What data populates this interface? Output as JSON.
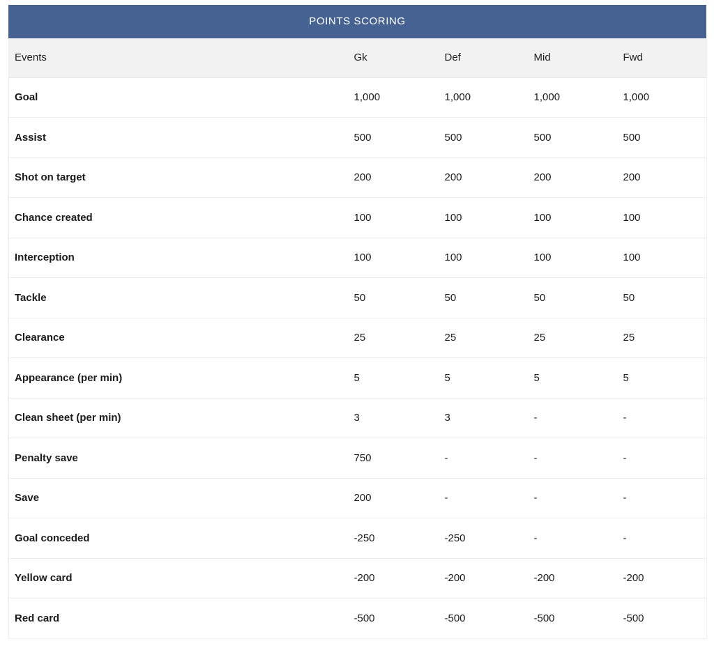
{
  "table": {
    "title": "POINTS SCORING",
    "accent_color": "#456293",
    "header_bg_color": "#f2f2f2",
    "columns": [
      {
        "key": "events",
        "label": "Events"
      },
      {
        "key": "gk",
        "label": "Gk"
      },
      {
        "key": "def",
        "label": "Def"
      },
      {
        "key": "mid",
        "label": "Mid"
      },
      {
        "key": "fwd",
        "label": "Fwd"
      }
    ],
    "rows": [
      {
        "event": "Goal",
        "gk": "1,000",
        "def": "1,000",
        "mid": "1,000",
        "fwd": "1,000"
      },
      {
        "event": "Assist",
        "gk": "500",
        "def": "500",
        "mid": "500",
        "fwd": "500"
      },
      {
        "event": "Shot on target",
        "gk": "200",
        "def": "200",
        "mid": "200",
        "fwd": "200"
      },
      {
        "event": "Chance created",
        "gk": "100",
        "def": "100",
        "mid": "100",
        "fwd": "100"
      },
      {
        "event": "Interception",
        "gk": "100",
        "def": "100",
        "mid": "100",
        "fwd": "100"
      },
      {
        "event": "Tackle",
        "gk": "50",
        "def": "50",
        "mid": "50",
        "fwd": "50"
      },
      {
        "event": "Clearance",
        "gk": "25",
        "def": "25",
        "mid": "25",
        "fwd": "25"
      },
      {
        "event": "Appearance (per min)",
        "gk": "5",
        "def": "5",
        "mid": "5",
        "fwd": "5"
      },
      {
        "event": "Clean sheet (per min)",
        "gk": "3",
        "def": "3",
        "mid": "-",
        "fwd": "-"
      },
      {
        "event": "Penalty save",
        "gk": "750",
        "def": "-",
        "mid": "-",
        "fwd": "-"
      },
      {
        "event": "Save",
        "gk": "200",
        "def": "-",
        "mid": "-",
        "fwd": "-"
      },
      {
        "event": "Goal conceded",
        "gk": "-250",
        "def": "-250",
        "mid": "-",
        "fwd": "-"
      },
      {
        "event": "Yellow card",
        "gk": "-200",
        "def": "-200",
        "mid": "-200",
        "fwd": "-200"
      },
      {
        "event": "Red card",
        "gk": "-500",
        "def": "-500",
        "mid": "-500",
        "fwd": "-500"
      }
    ]
  }
}
